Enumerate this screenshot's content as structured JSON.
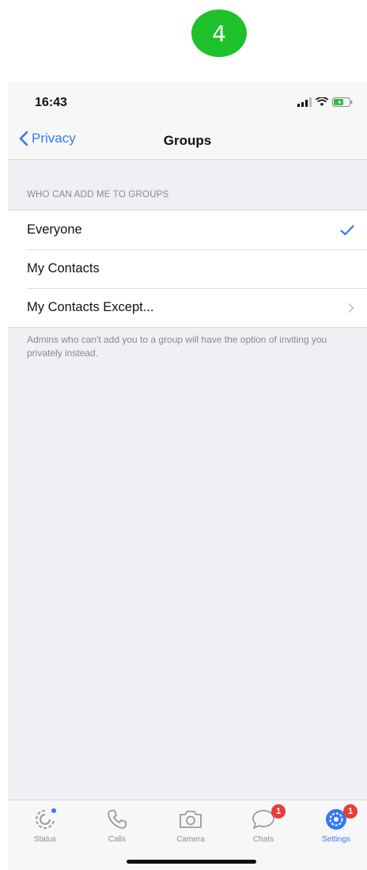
{
  "step_badge": "4",
  "status_bar": {
    "time": "16:43"
  },
  "nav": {
    "back_label": "Privacy",
    "title": "Groups"
  },
  "section_header": "WHO CAN ADD ME TO GROUPS",
  "options": [
    {
      "label": "Everyone",
      "accessory": "checkmark-icon"
    },
    {
      "label": "My Contacts",
      "accessory": ""
    },
    {
      "label": "My Contacts Except...",
      "accessory": "chevron-right-icon"
    }
  ],
  "footer_note": "Admins who can't add you to a group will have the option of inviting you privately instead.",
  "tabs": [
    {
      "label": "Status",
      "icon": "status-icon",
      "badge": ""
    },
    {
      "label": "Calls",
      "icon": "phone-icon",
      "badge": ""
    },
    {
      "label": "Camera",
      "icon": "camera-icon",
      "badge": ""
    },
    {
      "label": "Chats",
      "icon": "chat-bubble-icon",
      "badge": "1"
    },
    {
      "label": "Settings",
      "icon": "gear-icon",
      "badge": "1"
    }
  ],
  "colors": {
    "accent": "#3478f6",
    "badge": "#ea3b35",
    "step_badge": "#1fc12a"
  }
}
